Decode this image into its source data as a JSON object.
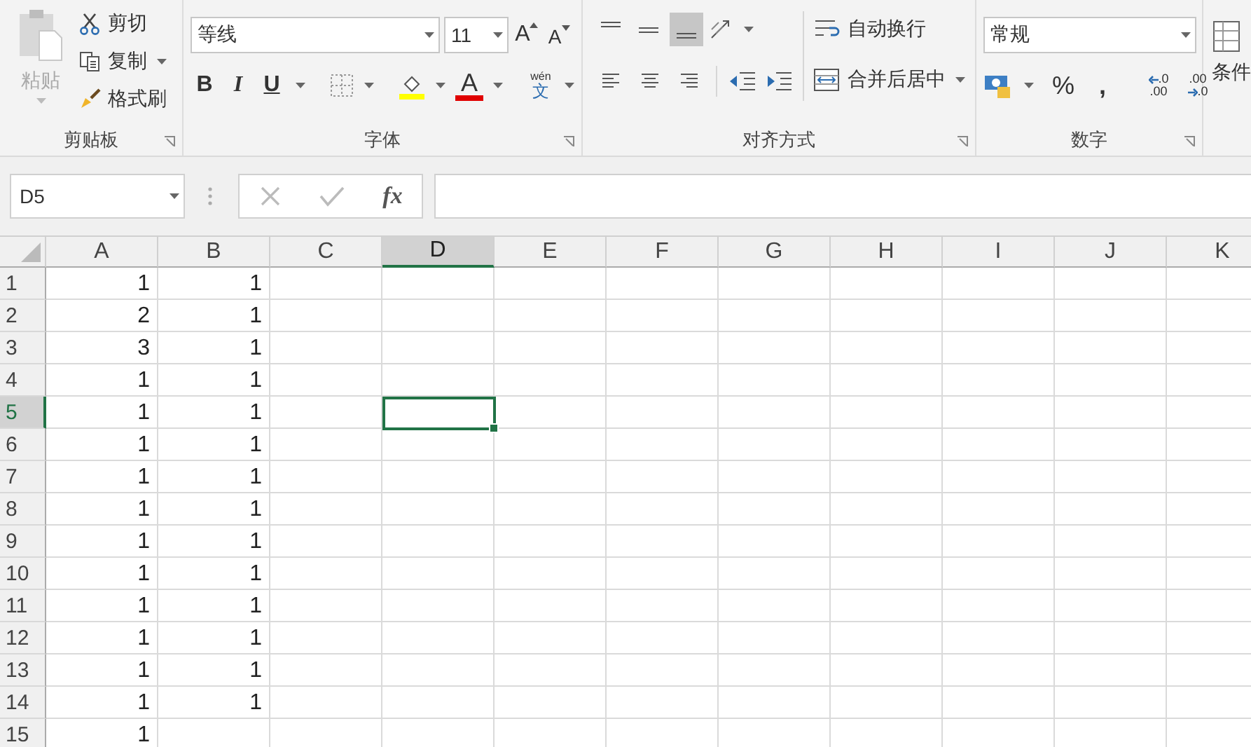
{
  "ribbon": {
    "clipboard": {
      "paste": "粘贴",
      "cut": "剪切",
      "copy": "复制",
      "format_painter": "格式刷",
      "label": "剪贴板"
    },
    "font": {
      "font_name": "等线",
      "font_size": "11",
      "grow": "A",
      "shrink": "A",
      "bold": "B",
      "italic": "I",
      "underline": "U",
      "font_color": "A",
      "phonetic_top": "wén",
      "phonetic": "文",
      "label": "字体"
    },
    "alignment": {
      "vertical_align": [
        {
          "kind": "top",
          "selected": false
        },
        {
          "kind": "middle",
          "selected": false
        },
        {
          "kind": "bottom",
          "selected": true
        }
      ],
      "horizontal_align": [
        {
          "kind": "left",
          "selected": false
        },
        {
          "kind": "center",
          "selected": false
        },
        {
          "kind": "right",
          "selected": false
        }
      ],
      "wrap_text": "自动换行",
      "merge_center": "合并后居中",
      "label": "对齐方式"
    },
    "number": {
      "format": "常规",
      "percent": "%",
      "comma": ",",
      "increase_decimal": [
        ".0",
        ".00"
      ],
      "decrease_decimal": [
        ".00",
        ".0"
      ],
      "label": "数字"
    },
    "styles": {
      "conditional_format": "条件"
    }
  },
  "formula_bar": {
    "name_box": "D5",
    "fx": "fx"
  },
  "grid": {
    "columns": [
      {
        "name": "A",
        "selected": false
      },
      {
        "name": "B",
        "selected": false
      },
      {
        "name": "C",
        "selected": false
      },
      {
        "name": "D",
        "selected": true
      },
      {
        "name": "E",
        "selected": false
      },
      {
        "name": "F",
        "selected": false
      },
      {
        "name": "G",
        "selected": false
      },
      {
        "name": "H",
        "selected": false
      },
      {
        "name": "I",
        "selected": false
      },
      {
        "name": "J",
        "selected": false
      },
      {
        "name": "K",
        "selected": false
      }
    ],
    "rows": [
      {
        "header": "1",
        "selected": false,
        "cells": [
          "1",
          "1"
        ]
      },
      {
        "header": "2",
        "selected": false,
        "cells": [
          "2",
          "1"
        ]
      },
      {
        "header": "3",
        "selected": false,
        "cells": [
          "3",
          "1"
        ]
      },
      {
        "header": "4",
        "selected": false,
        "cells": [
          "1",
          "1"
        ]
      },
      {
        "header": "5",
        "selected": true,
        "cells": [
          "1",
          "1"
        ]
      },
      {
        "header": "6",
        "selected": false,
        "cells": [
          "1",
          "1"
        ]
      },
      {
        "header": "7",
        "selected": false,
        "cells": [
          "1",
          "1"
        ]
      },
      {
        "header": "8",
        "selected": false,
        "cells": [
          "1",
          "1"
        ]
      },
      {
        "header": "9",
        "selected": false,
        "cells": [
          "1",
          "1"
        ]
      },
      {
        "header": "10",
        "selected": false,
        "cells": [
          "1",
          "1"
        ]
      },
      {
        "header": "11",
        "selected": false,
        "cells": [
          "1",
          "1"
        ]
      },
      {
        "header": "12",
        "selected": false,
        "cells": [
          "1",
          "1"
        ]
      },
      {
        "header": "13",
        "selected": false,
        "cells": [
          "1",
          "1"
        ]
      },
      {
        "header": "14",
        "selected": false,
        "cells": [
          "1",
          "1"
        ]
      },
      {
        "header": "15",
        "selected": false,
        "cells": [
          "1"
        ]
      }
    ]
  }
}
